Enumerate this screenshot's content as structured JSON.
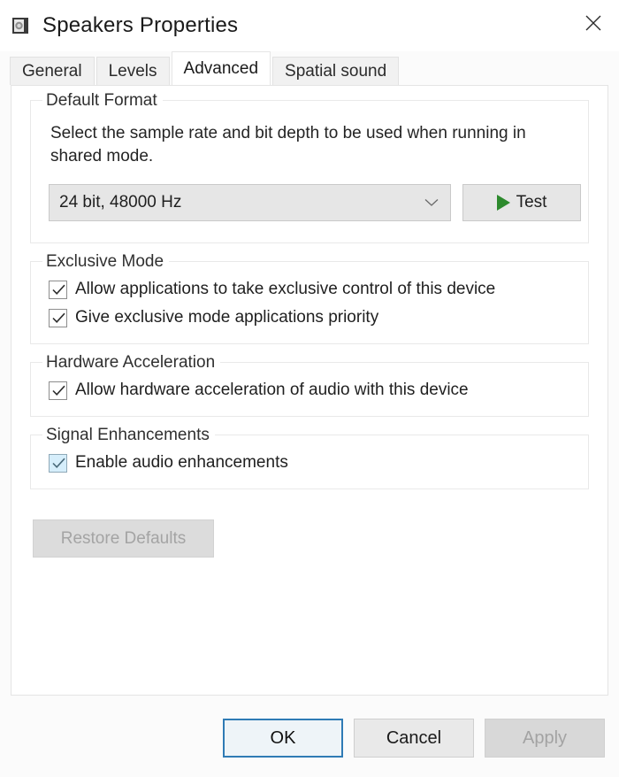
{
  "window": {
    "title": "Speakers Properties",
    "icon": "speaker-icon",
    "close_label": "✕"
  },
  "tabs": [
    {
      "label": "General",
      "selected": false
    },
    {
      "label": "Levels",
      "selected": false
    },
    {
      "label": "Advanced",
      "selected": true
    },
    {
      "label": "Spatial sound",
      "selected": false
    }
  ],
  "default_format": {
    "legend": "Default Format",
    "description": "Select the sample rate and bit depth to be used when running in shared mode.",
    "combo_value": "24 bit, 48000 Hz",
    "combo_icon": "chevron-down-icon",
    "test_label": "Test",
    "test_icon": "play-icon"
  },
  "exclusive_mode": {
    "legend": "Exclusive Mode",
    "items": [
      {
        "label": "Allow applications to take exclusive control of this device",
        "checked": true
      },
      {
        "label": "Give exclusive mode applications priority",
        "checked": true
      }
    ]
  },
  "hardware_acceleration": {
    "legend": "Hardware Acceleration",
    "items": [
      {
        "label": "Allow hardware acceleration of audio with this device",
        "checked": true
      }
    ]
  },
  "signal_enhancements": {
    "legend": "Signal Enhancements",
    "items": [
      {
        "label": "Enable audio enhancements",
        "checked": true,
        "highlighted": true
      }
    ]
  },
  "restore": {
    "label": "Restore Defaults",
    "enabled": false
  },
  "footer": {
    "ok_label": "OK",
    "cancel_label": "Cancel",
    "apply_label": "Apply",
    "apply_enabled": false
  },
  "colors": {
    "accent": "#2f7bb5",
    "play_green": "#2d8a2d",
    "highlight_checkbox": "#d6eefb",
    "disabled_text": "#a4a4a4"
  }
}
